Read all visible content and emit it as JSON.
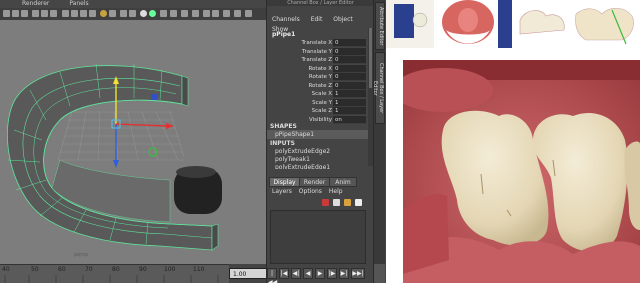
{
  "viewport": {
    "menu": [
      "",
      "Renderer",
      "Panels"
    ],
    "camera_label": "persp"
  },
  "timeline": {
    "ticks": [
      "40",
      "50",
      "60",
      "70",
      "80",
      "90",
      "100",
      "110"
    ],
    "current_time": "1.00"
  },
  "channel_box": {
    "title": "Channel Box / Layer Editor",
    "menu": [
      "Channels",
      "Edit",
      "Object",
      "Show"
    ],
    "node": "pPipe1",
    "attributes": [
      {
        "label": "Translate X",
        "value": "0"
      },
      {
        "label": "Translate Y",
        "value": "0"
      },
      {
        "label": "Translate Z",
        "value": "0"
      },
      {
        "label": "Rotate X",
        "value": "0"
      },
      {
        "label": "Rotate Y",
        "value": "0"
      },
      {
        "label": "Rotate Z",
        "value": "0"
      },
      {
        "label": "Scale X",
        "value": "1"
      },
      {
        "label": "Scale Y",
        "value": "1"
      },
      {
        "label": "Scale Z",
        "value": "1"
      },
      {
        "label": "Visibility",
        "value": "on"
      }
    ],
    "shapes_header": "SHAPES",
    "shape": "pPipeShape1",
    "inputs_header": "INPUTS",
    "inputs": [
      "polyExtrudeEdge2",
      "polyTweak1",
      "polyExtrudeEdge1"
    ]
  },
  "layer_editor": {
    "tabs": [
      "Display",
      "Render",
      "Anim"
    ],
    "menu": [
      "Layers",
      "Options",
      "Help"
    ]
  },
  "side_strip": {
    "tabs": [
      "Attribute Editor",
      "Channel Box / Layer Editor"
    ]
  },
  "playback": {
    "buttons": [
      "|◀◀",
      "|◀",
      "◀|",
      "◀",
      "▶",
      "|▶",
      "▶|",
      "▶▶|"
    ]
  },
  "colors": {
    "wire": "#5fe39a",
    "viewport_bg": "#7d7d7d",
    "gum": "#c25b5e",
    "tooth": "#e6dcc0"
  },
  "icons": [
    "move-manipulator-icon",
    "layer-new-icon",
    "layer-delete-icon"
  ]
}
